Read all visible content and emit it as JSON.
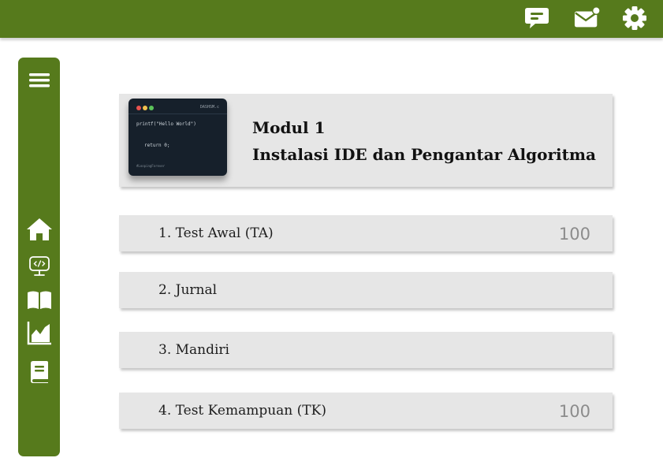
{
  "colors": {
    "brand": "#567a1c",
    "card": "#e6e6e6",
    "score": "#8c8c8c"
  },
  "topbar": {
    "icons": [
      "chat-icon",
      "mail-notification-icon",
      "gear-icon"
    ]
  },
  "sidebar": {
    "items": [
      {
        "icon": "menu-icon"
      },
      {
        "icon": "home-icon"
      },
      {
        "icon": "code-monitor-icon"
      },
      {
        "icon": "book-icon"
      },
      {
        "icon": "chart-icon"
      },
      {
        "icon": "notebook-icon"
      }
    ]
  },
  "module": {
    "title_line1": "Modul 1",
    "title_line2": "Instalasi IDE dan Pengantar Algoritma",
    "thumbnail": {
      "filename": "DASHSM.c",
      "code_line1": "printf(\"Hello World\")",
      "code_line2": "return 0;",
      "tag": "#LoopingForever"
    }
  },
  "tasks": [
    {
      "label": "1. Test Awal (TA)",
      "score": "100"
    },
    {
      "label": "2. Jurnal",
      "score": ""
    },
    {
      "label": "3. Mandiri",
      "score": ""
    },
    {
      "label": "4. Test Kemampuan (TK)",
      "score": "100"
    }
  ]
}
